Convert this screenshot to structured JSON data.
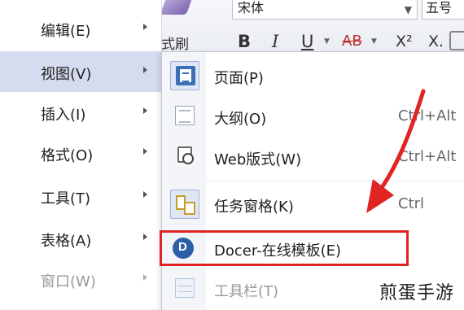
{
  "toolbar": {
    "painter_label": "式刷",
    "font_name": "宋体",
    "font_size": "五号",
    "bold": "B",
    "italic": "I",
    "underline": "U",
    "strikethrough": "AB",
    "superscript": "X²",
    "subscript": "X."
  },
  "main_menu": {
    "items": [
      {
        "label": "编辑(E)"
      },
      {
        "label": "视图(V)"
      },
      {
        "label": "插入(I)"
      },
      {
        "label": "格式(O)"
      },
      {
        "label": "工具(T)"
      },
      {
        "label": "表格(A)"
      },
      {
        "label": "窗口(W)"
      }
    ]
  },
  "submenu": {
    "items": [
      {
        "label": "页面(P)",
        "shortcut": "",
        "icon": "page-view-icon"
      },
      {
        "label": "大纲(O)",
        "shortcut": "Ctrl+Alt",
        "icon": "outline-view-icon"
      },
      {
        "label": "Web版式(W)",
        "shortcut": "Ctrl+Alt",
        "icon": "web-layout-icon"
      },
      {
        "label": "任务窗格(K)",
        "shortcut": "Ctrl",
        "icon": "task-pane-icon"
      },
      {
        "label": "Docer-在线模板(E)",
        "shortcut": "",
        "icon": "docer-icon"
      },
      {
        "label": "工具栏(T)",
        "shortcut": "",
        "icon": "toolbar-icon"
      }
    ]
  },
  "annotation": {
    "highlight_color": "#e02424"
  },
  "watermark": "煎蛋手游"
}
